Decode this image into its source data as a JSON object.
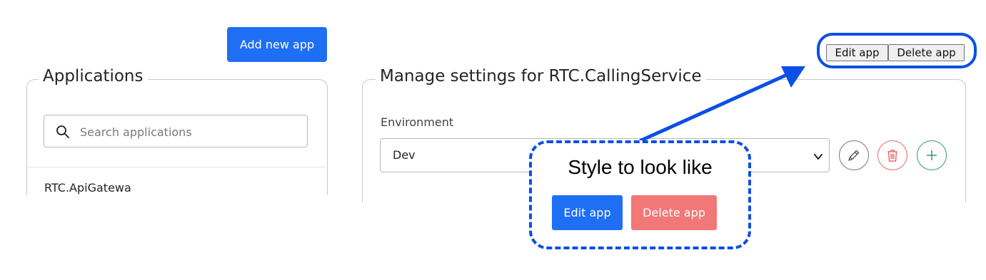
{
  "toolbar": {
    "add_app_label": "Add new app"
  },
  "applications": {
    "legend": "Applications",
    "search": {
      "placeholder": "Search applications",
      "value": ""
    },
    "items": [
      {
        "label": "RTC.ApiGatewa"
      }
    ]
  },
  "manage": {
    "legend": "Manage settings for RTC.CallingService",
    "environment_label": "Environment",
    "environment_value": "Dev",
    "icons": [
      "pencil-icon",
      "trash-icon",
      "plus-icon"
    ]
  },
  "plain_buttons": {
    "edit_label": "Edit app",
    "delete_label": "Delete app"
  },
  "callout": {
    "title": "Style to look like",
    "edit_label": "Edit app",
    "delete_label": "Delete app"
  },
  "colors": {
    "primary": "#1f6ff5",
    "danger_light": "#f27878",
    "danger_icon": "#e46a6a",
    "success_icon": "#2e9e6a",
    "annotation_blue": "#0b4fe6"
  }
}
